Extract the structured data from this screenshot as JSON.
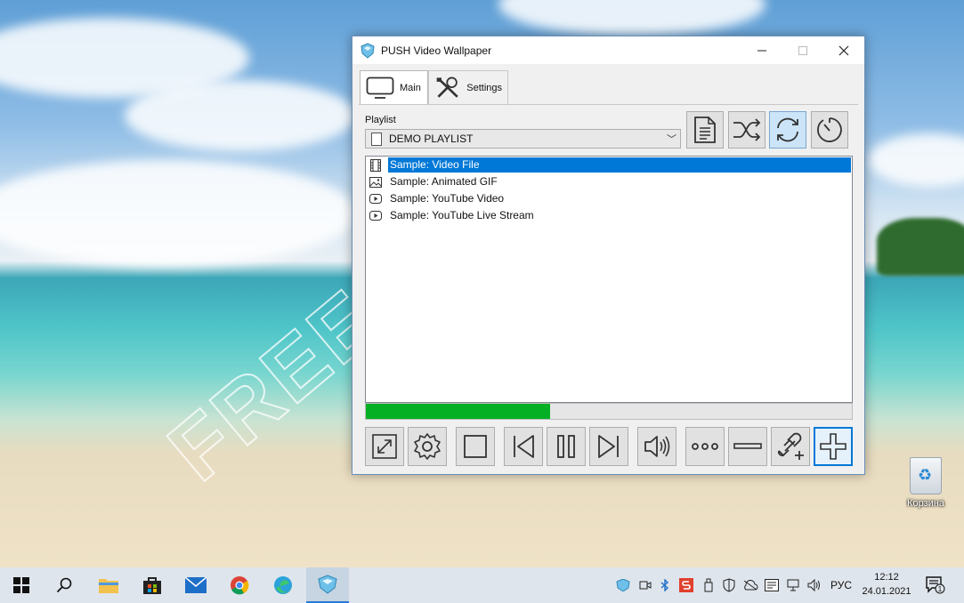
{
  "window": {
    "title": "PUSH Video Wallpaper",
    "controls": {
      "minimize": "minimize",
      "maximize": "maximize",
      "close": "close"
    }
  },
  "tabs": [
    {
      "label": "Main",
      "icon": "monitor-icon",
      "active": true
    },
    {
      "label": "Settings",
      "icon": "tools-icon",
      "active": false
    }
  ],
  "playlist": {
    "label": "Playlist",
    "selected": "DEMO PLAYLIST",
    "toolbar": [
      "playlist-file-icon",
      "shuffle-icon",
      "repeat-icon",
      "timer-icon"
    ],
    "items": [
      {
        "label": "Sample: Video File",
        "icon": "film-icon",
        "selected": true
      },
      {
        "label": "Sample: Animated GIF",
        "icon": "image-icon",
        "selected": false
      },
      {
        "label": "Sample: YouTube Video",
        "icon": "youtube-icon",
        "selected": false
      },
      {
        "label": "Sample: YouTube Live Stream",
        "icon": "youtube-icon",
        "selected": false
      }
    ]
  },
  "progress": {
    "fraction": 0.38,
    "color": "#06b025"
  },
  "controls": [
    "fullscreen-icon",
    "gear-icon",
    "stop-icon",
    "previous-icon",
    "pause-icon",
    "next-icon",
    "volume-icon",
    "more-icon",
    "remove-icon",
    "add-url-icon",
    "add-icon"
  ],
  "watermark": "FREESOFT.SPACE",
  "desktop": {
    "recycle_bin_label": "Корзина"
  },
  "taskbar": {
    "apps": [
      "start-icon",
      "search-icon",
      "file-explorer-icon",
      "store-icon",
      "mail-icon",
      "chrome-icon",
      "edge-icon",
      "push-video-wallpaper-icon"
    ],
    "language": "РУС",
    "time": "12:12",
    "date": "24.01.2021",
    "notification_count": "1"
  },
  "colors": {
    "accent": "#0078d7",
    "progress": "#06b025"
  }
}
